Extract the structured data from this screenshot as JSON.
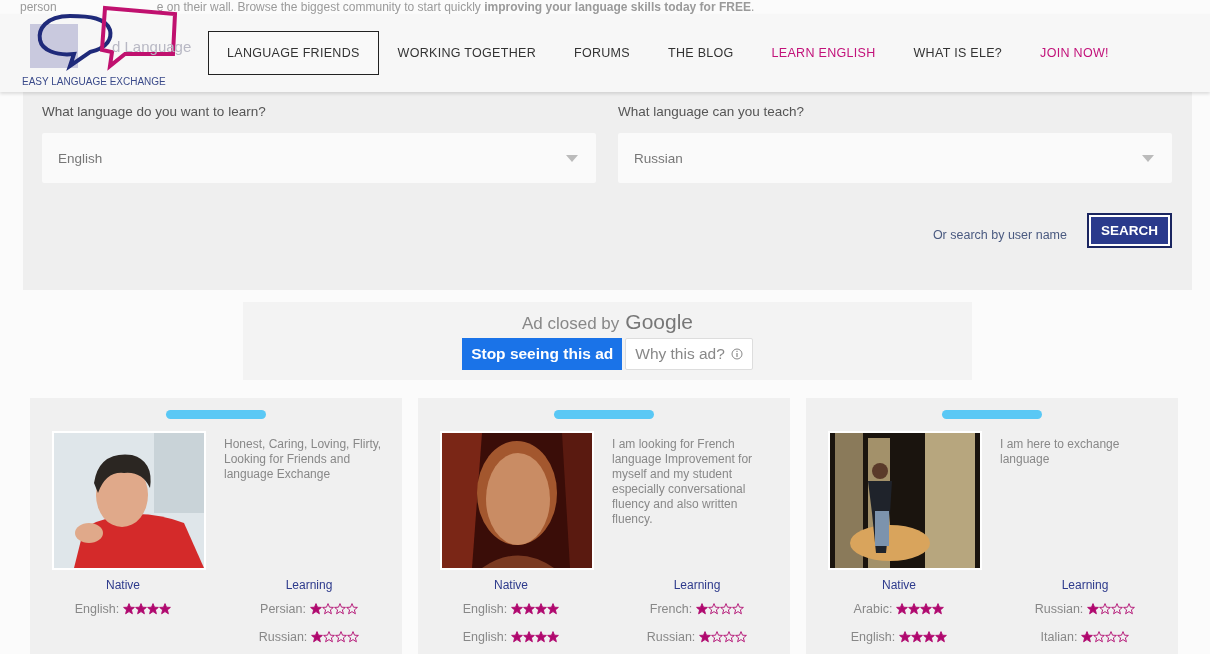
{
  "intro": {
    "lead": "person",
    "text": "e on their wall. Browse the biggest community to start quickly **improving your language skills today for FREE**."
  },
  "logo": {
    "caption": "EASY LANGUAGE EXCHANGE"
  },
  "hidden_heading": "d Language",
  "nav": [
    {
      "label": "LANGUAGE FRIENDS",
      "selected": true,
      "highlight": false
    },
    {
      "label": "WORKING TOGETHER",
      "selected": false,
      "highlight": false
    },
    {
      "label": "FORUMS",
      "selected": false,
      "highlight": false
    },
    {
      "label": "THE BLOG",
      "selected": false,
      "highlight": false
    },
    {
      "label": "LEARN ENGLISH",
      "selected": false,
      "highlight": true
    },
    {
      "label": "WHAT IS ELE?",
      "selected": false,
      "highlight": false
    },
    {
      "label": "JOIN NOW!",
      "selected": false,
      "highlight": true
    }
  ],
  "search": {
    "fields": [
      {
        "label": "What language do you want to learn?",
        "value": "English"
      },
      {
        "label": "What language can you teach?",
        "value": "Russian"
      }
    ],
    "username_link": "Or search by user name",
    "button": "SEARCH"
  },
  "ad": {
    "text": "Ad closed by",
    "brand": "Google",
    "stop": "Stop seeing this ad",
    "why": "Why this ad?"
  },
  "profiles": [
    {
      "bio": "Honest, Caring, Loving, Flirty, Looking for Friends and language Exchange",
      "native_heading": "Native",
      "learning_heading": "Learning",
      "native": [
        {
          "language": "English:",
          "stars": 4
        }
      ],
      "learning": [
        {
          "language": "Persian:",
          "stars": 1
        },
        {
          "language": "Russian:",
          "stars": 1
        }
      ]
    },
    {
      "bio": "I am looking for French language Improvement for myself and my student especially conversational fluency and also written fluency.",
      "native_heading": "Native",
      "learning_heading": "Learning",
      "native": [
        {
          "language": "English:",
          "stars": 4
        },
        {
          "language": "English:",
          "stars": 4
        }
      ],
      "learning": [
        {
          "language": "French:",
          "stars": 1
        },
        {
          "language": "Russian:",
          "stars": 1
        }
      ]
    },
    {
      "bio": "I am here to exchange language",
      "native_heading": "Native",
      "learning_heading": "Learning",
      "native": [
        {
          "language": "Arabic:",
          "stars": 4
        },
        {
          "language": "English:",
          "stars": 4
        }
      ],
      "learning": [
        {
          "language": "Russian:",
          "stars": 1
        },
        {
          "language": "Italian:",
          "stars": 1
        }
      ]
    }
  ]
}
